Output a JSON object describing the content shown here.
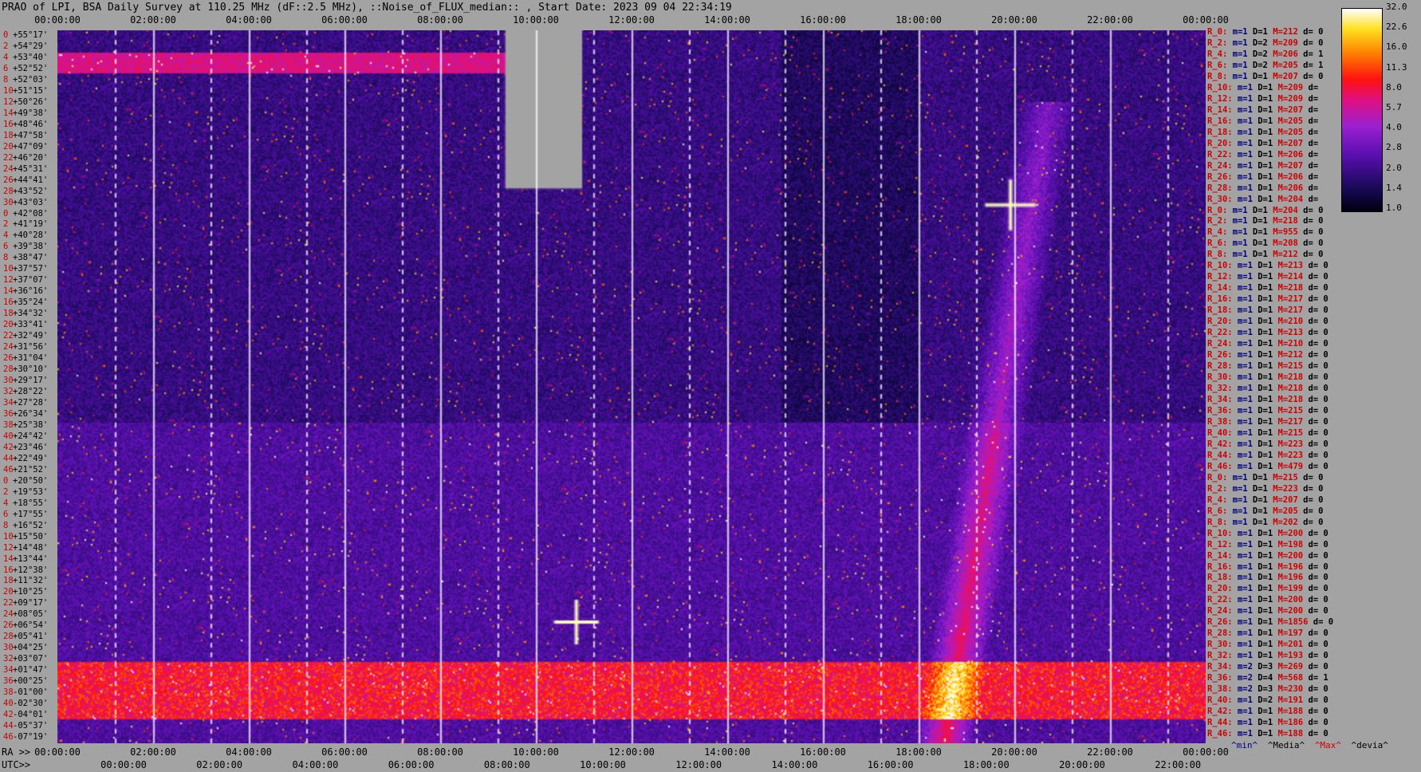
{
  "title": "PRAO of LPI, BSA Daily Survey at 110.25 MHz (dF::2.5 MHz), ::Noise_of_FLUX_median:: , Start Date: 2023 09 04 22:34:19",
  "chart_data": {
    "type": "heatmap",
    "top_axis_ticks": [
      "00:00:00",
      "02:00:00",
      "04:00:00",
      "06:00:00",
      "08:00:00",
      "10:00:00",
      "12:00:00",
      "14:00:00",
      "16:00:00",
      "18:00:00",
      "20:00:00",
      "22:00:00",
      "00:00:00"
    ],
    "ra_label": "RA >>",
    "ra_axis_ticks": [
      "00:00:00",
      "02:00:00",
      "04:00:00",
      "06:00:00",
      "08:00:00",
      "10:00:00",
      "12:00:00",
      "14:00:00",
      "16:00:00",
      "18:00:00",
      "20:00:00",
      "22:00:00",
      "00:00:00"
    ],
    "utc_label": "UTC>>",
    "utc_axis_ticks": [
      "00:00:00",
      "02:00:00",
      "04:00:00",
      "06:00:00",
      "08:00:00",
      "10:00:00",
      "12:00:00",
      "14:00:00",
      "16:00:00",
      "18:00:00",
      "20:00:00",
      "22:00:00"
    ],
    "dec_labels": [
      {
        "idx": "0",
        "dec": "+55°17'"
      },
      {
        "idx": "2",
        "dec": "+54°29'"
      },
      {
        "idx": "4",
        "dec": "+53°40'"
      },
      {
        "idx": "6",
        "dec": "+52°52'"
      },
      {
        "idx": "8",
        "dec": "+52°03'"
      },
      {
        "idx": "10",
        "dec": "+51°15'"
      },
      {
        "idx": "12",
        "dec": "+50°26'"
      },
      {
        "idx": "14",
        "dec": "+49°38'"
      },
      {
        "idx": "16",
        "dec": "+48°46'"
      },
      {
        "idx": "18",
        "dec": "+47°58'"
      },
      {
        "idx": "20",
        "dec": "+47°09'"
      },
      {
        "idx": "22",
        "dec": "+46°20'"
      },
      {
        "idx": "24",
        "dec": "+45°31'"
      },
      {
        "idx": "26",
        "dec": "+44°41'"
      },
      {
        "idx": "28",
        "dec": "+43°52'"
      },
      {
        "idx": "30",
        "dec": "+43°03'"
      },
      {
        "idx": "0",
        "dec": "+42°08'"
      },
      {
        "idx": "2",
        "dec": "+41°19'"
      },
      {
        "idx": "4",
        "dec": "+40°28'"
      },
      {
        "idx": "6",
        "dec": "+39°38'"
      },
      {
        "idx": "8",
        "dec": "+38°47'"
      },
      {
        "idx": "10",
        "dec": "+37°57'"
      },
      {
        "idx": "12",
        "dec": "+37°07'"
      },
      {
        "idx": "14",
        "dec": "+36°16'"
      },
      {
        "idx": "16",
        "dec": "+35°24'"
      },
      {
        "idx": "18",
        "dec": "+34°32'"
      },
      {
        "idx": "20",
        "dec": "+33°41'"
      },
      {
        "idx": "22",
        "dec": "+32°49'"
      },
      {
        "idx": "24",
        "dec": "+31°56'"
      },
      {
        "idx": "26",
        "dec": "+31°04'"
      },
      {
        "idx": "28",
        "dec": "+30°10'"
      },
      {
        "idx": "30",
        "dec": "+29°17'"
      },
      {
        "idx": "32",
        "dec": "+28°22'"
      },
      {
        "idx": "34",
        "dec": "+27°28'"
      },
      {
        "idx": "36",
        "dec": "+26°34'"
      },
      {
        "idx": "38",
        "dec": "+25°38'"
      },
      {
        "idx": "40",
        "dec": "+24°42'"
      },
      {
        "idx": "42",
        "dec": "+23°46'"
      },
      {
        "idx": "44",
        "dec": "+22°49'"
      },
      {
        "idx": "46",
        "dec": "+21°52'"
      },
      {
        "idx": "0",
        "dec": "+20°50'"
      },
      {
        "idx": "2",
        "dec": "+19°53'"
      },
      {
        "idx": "4",
        "dec": "+18°55'"
      },
      {
        "idx": "6",
        "dec": "+17°55'"
      },
      {
        "idx": "8",
        "dec": "+16°52'"
      },
      {
        "idx": "10",
        "dec": "+15°50'"
      },
      {
        "idx": "12",
        "dec": "+14°48'"
      },
      {
        "idx": "14",
        "dec": "+13°44'"
      },
      {
        "idx": "16",
        "dec": "+12°38'"
      },
      {
        "idx": "18",
        "dec": "+11°32'"
      },
      {
        "idx": "20",
        "dec": "+10°25'"
      },
      {
        "idx": "22",
        "dec": "+09°17'"
      },
      {
        "idx": "24",
        "dec": "+08°05'"
      },
      {
        "idx": "26",
        "dec": "+06°54'"
      },
      {
        "idx": "28",
        "dec": "+05°41'"
      },
      {
        "idx": "30",
        "dec": "+04°25'"
      },
      {
        "idx": "32",
        "dec": "+03°07'"
      },
      {
        "idx": "34",
        "dec": "+01°47'"
      },
      {
        "idx": "36",
        "dec": "+00°25'"
      },
      {
        "idx": "38",
        "dec": "-01°00'"
      },
      {
        "idx": "40",
        "dec": "-02°30'"
      },
      {
        "idx": "42",
        "dec": "-04°01'"
      },
      {
        "idx": "44",
        "dec": "-05°37'"
      },
      {
        "idx": "46",
        "dec": "-07°19'"
      }
    ],
    "stats": [
      {
        "r": "R_0:",
        "m": "1",
        "D": "1",
        "M": "212",
        "d": "0"
      },
      {
        "r": "R_2:",
        "m": "1",
        "D": "2",
        "M": "209",
        "d": "0"
      },
      {
        "r": "R_4:",
        "m": "1",
        "D": "2",
        "M": "206",
        "d": "1"
      },
      {
        "r": "R_6:",
        "m": "1",
        "D": "2",
        "M": "205",
        "d": "1"
      },
      {
        "r": "R_8:",
        "m": "1",
        "D": "1",
        "M": "207",
        "d": "0"
      },
      {
        "r": "R_10:",
        "m": "1",
        "D": "1",
        "M": "209",
        "d": ""
      },
      {
        "r": "R_12:",
        "m": "1",
        "D": "1",
        "M": "209",
        "d": ""
      },
      {
        "r": "R_14:",
        "m": "1",
        "D": "1",
        "M": "207",
        "d": ""
      },
      {
        "r": "R_16:",
        "m": "1",
        "D": "1",
        "M": "205",
        "d": ""
      },
      {
        "r": "R_18:",
        "m": "1",
        "D": "1",
        "M": "205",
        "d": ""
      },
      {
        "r": "R_20:",
        "m": "1",
        "D": "1",
        "M": "207",
        "d": ""
      },
      {
        "r": "R_22:",
        "m": "1",
        "D": "1",
        "M": "206",
        "d": ""
      },
      {
        "r": "R_24:",
        "m": "1",
        "D": "1",
        "M": "207",
        "d": ""
      },
      {
        "r": "R_26:",
        "m": "1",
        "D": "1",
        "M": "206",
        "d": ""
      },
      {
        "r": "R_28:",
        "m": "1",
        "D": "1",
        "M": "206",
        "d": ""
      },
      {
        "r": "R_30:",
        "m": "1",
        "D": "1",
        "M": "204",
        "d": ""
      },
      {
        "r": "R_0:",
        "m": "1",
        "D": "1",
        "M": "204",
        "d": "0"
      },
      {
        "r": "R_2:",
        "m": "1",
        "D": "1",
        "M": "218",
        "d": "0"
      },
      {
        "r": "R_4:",
        "m": "1",
        "D": "1",
        "M": "955",
        "d": "0"
      },
      {
        "r": "R_6:",
        "m": "1",
        "D": "1",
        "M": "208",
        "d": "0"
      },
      {
        "r": "R_8:",
        "m": "1",
        "D": "1",
        "M": "212",
        "d": "0"
      },
      {
        "r": "R_10:",
        "m": "1",
        "D": "1",
        "M": "213",
        "d": "0"
      },
      {
        "r": "R_12:",
        "m": "1",
        "D": "1",
        "M": "214",
        "d": "0"
      },
      {
        "r": "R_14:",
        "m": "1",
        "D": "1",
        "M": "218",
        "d": "0"
      },
      {
        "r": "R_16:",
        "m": "1",
        "D": "1",
        "M": "217",
        "d": "0"
      },
      {
        "r": "R_18:",
        "m": "1",
        "D": "1",
        "M": "217",
        "d": "0"
      },
      {
        "r": "R_20:",
        "m": "1",
        "D": "1",
        "M": "210",
        "d": "0"
      },
      {
        "r": "R_22:",
        "m": "1",
        "D": "1",
        "M": "213",
        "d": "0"
      },
      {
        "r": "R_24:",
        "m": "1",
        "D": "1",
        "M": "210",
        "d": "0"
      },
      {
        "r": "R_26:",
        "m": "1",
        "D": "1",
        "M": "212",
        "d": "0"
      },
      {
        "r": "R_28:",
        "m": "1",
        "D": "1",
        "M": "215",
        "d": "0"
      },
      {
        "r": "R_30:",
        "m": "1",
        "D": "1",
        "M": "218",
        "d": "0"
      },
      {
        "r": "R_32:",
        "m": "1",
        "D": "1",
        "M": "218",
        "d": "0"
      },
      {
        "r": "R_34:",
        "m": "1",
        "D": "1",
        "M": "218",
        "d": "0"
      },
      {
        "r": "R_36:",
        "m": "1",
        "D": "1",
        "M": "215",
        "d": "0"
      },
      {
        "r": "R_38:",
        "m": "1",
        "D": "1",
        "M": "217",
        "d": "0"
      },
      {
        "r": "R_40:",
        "m": "1",
        "D": "1",
        "M": "215",
        "d": "0"
      },
      {
        "r": "R_42:",
        "m": "1",
        "D": "1",
        "M": "223",
        "d": "0"
      },
      {
        "r": "R_44:",
        "m": "1",
        "D": "1",
        "M": "223",
        "d": "0"
      },
      {
        "r": "R_46:",
        "m": "1",
        "D": "1",
        "M": "479",
        "d": "0"
      },
      {
        "r": "R_0:",
        "m": "1",
        "D": "1",
        "M": "215",
        "d": "0"
      },
      {
        "r": "R_2:",
        "m": "1",
        "D": "1",
        "M": "223",
        "d": "0"
      },
      {
        "r": "R_4:",
        "m": "1",
        "D": "1",
        "M": "207",
        "d": "0"
      },
      {
        "r": "R_6:",
        "m": "1",
        "D": "1",
        "M": "205",
        "d": "0"
      },
      {
        "r": "R_8:",
        "m": "1",
        "D": "1",
        "M": "202",
        "d": "0"
      },
      {
        "r": "R_10:",
        "m": "1",
        "D": "1",
        "M": "200",
        "d": "0"
      },
      {
        "r": "R_12:",
        "m": "1",
        "D": "1",
        "M": "198",
        "d": "0"
      },
      {
        "r": "R_14:",
        "m": "1",
        "D": "1",
        "M": "200",
        "d": "0"
      },
      {
        "r": "R_16:",
        "m": "1",
        "D": "1",
        "M": "196",
        "d": "0"
      },
      {
        "r": "R_18:",
        "m": "1",
        "D": "1",
        "M": "196",
        "d": "0"
      },
      {
        "r": "R_20:",
        "m": "1",
        "D": "1",
        "M": "199",
        "d": "0"
      },
      {
        "r": "R_22:",
        "m": "1",
        "D": "1",
        "M": "200",
        "d": "0"
      },
      {
        "r": "R_24:",
        "m": "1",
        "D": "1",
        "M": "200",
        "d": "0"
      },
      {
        "r": "R_26:",
        "m": "1",
        "D": "1",
        "M": "1856",
        "d": "0"
      },
      {
        "r": "R_28:",
        "m": "1",
        "D": "1",
        "M": "197",
        "d": "0"
      },
      {
        "r": "R_30:",
        "m": "1",
        "D": "1",
        "M": "201",
        "d": "0"
      },
      {
        "r": "R_32:",
        "m": "1",
        "D": "1",
        "M": "193",
        "d": "0"
      },
      {
        "r": "R_34:",
        "m": "2",
        "D": "3",
        "M": "269",
        "d": "0"
      },
      {
        "r": "R_36:",
        "m": "2",
        "D": "4",
        "M": "568",
        "d": "1"
      },
      {
        "r": "R_38:",
        "m": "2",
        "D": "3",
        "M": "230",
        "d": "0"
      },
      {
        "r": "R_40:",
        "m": "1",
        "D": "2",
        "M": "191",
        "d": "0"
      },
      {
        "r": "R_42:",
        "m": "1",
        "D": "1",
        "M": "188",
        "d": "0"
      },
      {
        "r": "R_44:",
        "m": "1",
        "D": "1",
        "M": "186",
        "d": "0"
      },
      {
        "r": "R_46:",
        "m": "1",
        "D": "1",
        "M": "188",
        "d": "0"
      }
    ],
    "colorbar_ticks": [
      "32.0",
      "22.6",
      "16.0",
      "11.3",
      "8.0",
      "5.7",
      "4.0",
      "2.8",
      "2.0",
      "1.4",
      "1.0"
    ],
    "legend": {
      "min": "^min^",
      "median": "^Media^",
      "max": "^Max^",
      "devia": "^devia^"
    }
  }
}
